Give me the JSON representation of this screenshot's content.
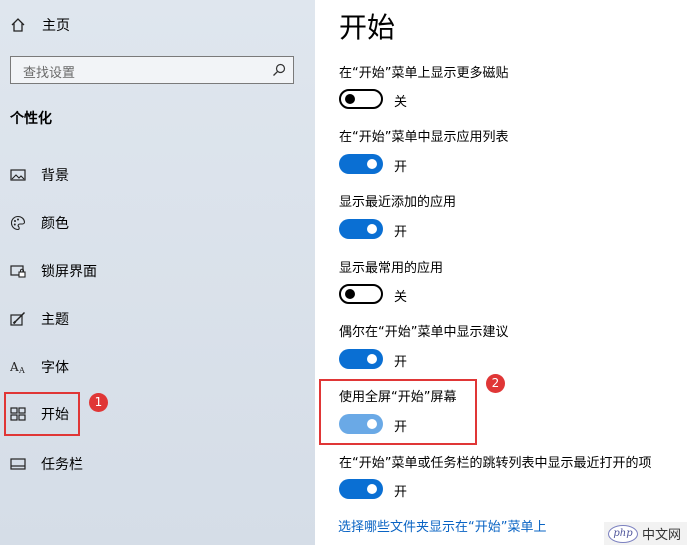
{
  "sidebar": {
    "home_label": "主页",
    "search_placeholder": "查找设置",
    "section_title": "个性化",
    "items": [
      {
        "label": "背景",
        "icon": "picture-icon"
      },
      {
        "label": "颜色",
        "icon": "palette-icon"
      },
      {
        "label": "锁屏界面",
        "icon": "lock-screen-icon"
      },
      {
        "label": "主题",
        "icon": "theme-brush-icon"
      },
      {
        "label": "字体",
        "icon": "font-icon"
      },
      {
        "label": "开始",
        "icon": "start-tiles-icon"
      },
      {
        "label": "任务栏",
        "icon": "taskbar-icon"
      }
    ]
  },
  "annotations": {
    "badge1": "1",
    "badge2": "2"
  },
  "main": {
    "title": "开始",
    "settings": [
      {
        "label": "在“开始”菜单上显示更多磁贴",
        "state": "关",
        "on": false
      },
      {
        "label": "在“开始”菜单中显示应用列表",
        "state": "开",
        "on": true
      },
      {
        "label": "显示最近添加的应用",
        "state": "开",
        "on": true
      },
      {
        "label": "显示最常用的应用",
        "state": "关",
        "on": false
      },
      {
        "label": "偶尔在“开始”菜单中显示建议",
        "state": "开",
        "on": true
      },
      {
        "label": "使用全屏“开始”屏幕",
        "state": "开",
        "on": true
      },
      {
        "label": "在“开始”菜单或任务栏的跳转列表中显示最近打开的项",
        "state": "开",
        "on": true
      }
    ],
    "link": "选择哪些文件夹显示在“开始”菜单上"
  },
  "watermark": {
    "logo": "php",
    "text": "中文网"
  },
  "colors": {
    "accent": "#0a6fd3",
    "highlight": "#e03636",
    "link": "#0a64c4"
  }
}
